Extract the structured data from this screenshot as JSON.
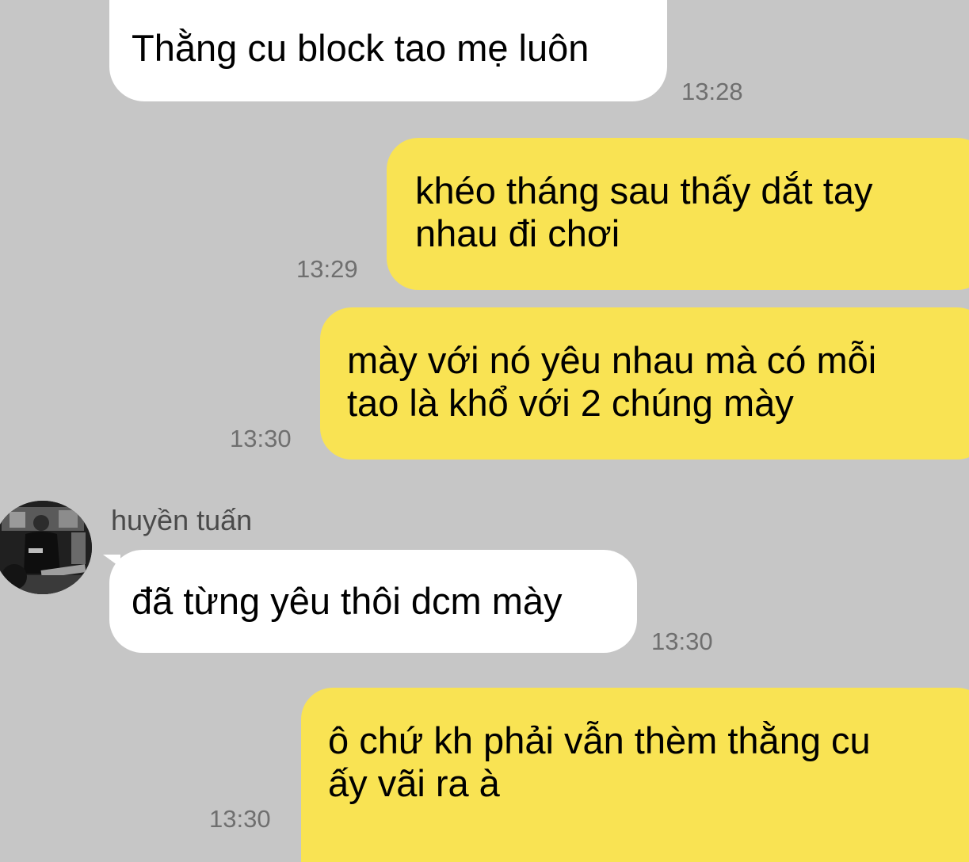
{
  "messages": [
    {
      "direction": "incoming",
      "text": "Thằng cu block tao mẹ luôn",
      "time": "13:28"
    },
    {
      "direction": "outgoing",
      "text": "khéo tháng sau thấy dắt tay\nnhau đi chơi",
      "time": "13:29"
    },
    {
      "direction": "outgoing",
      "text": "mày với nó yêu nhau mà có mỗi\ntao là khổ với 2 chúng mày",
      "time": "13:30"
    },
    {
      "direction": "incoming",
      "sender": "huyền tuấn",
      "text": "đã từng yêu thôi dcm mày",
      "time": "13:30"
    },
    {
      "direction": "outgoing",
      "text": "ô chứ kh phải vẫn thèm thằng cu\nấy vãi ra à",
      "time": "13:30"
    }
  ],
  "avatar_icon": "profile-photo-icon",
  "colors": {
    "background": "#c6c6c6",
    "incoming_bubble": "#ffffff",
    "outgoing_bubble": "#f9e353",
    "timestamp": "#6f6f6f"
  }
}
